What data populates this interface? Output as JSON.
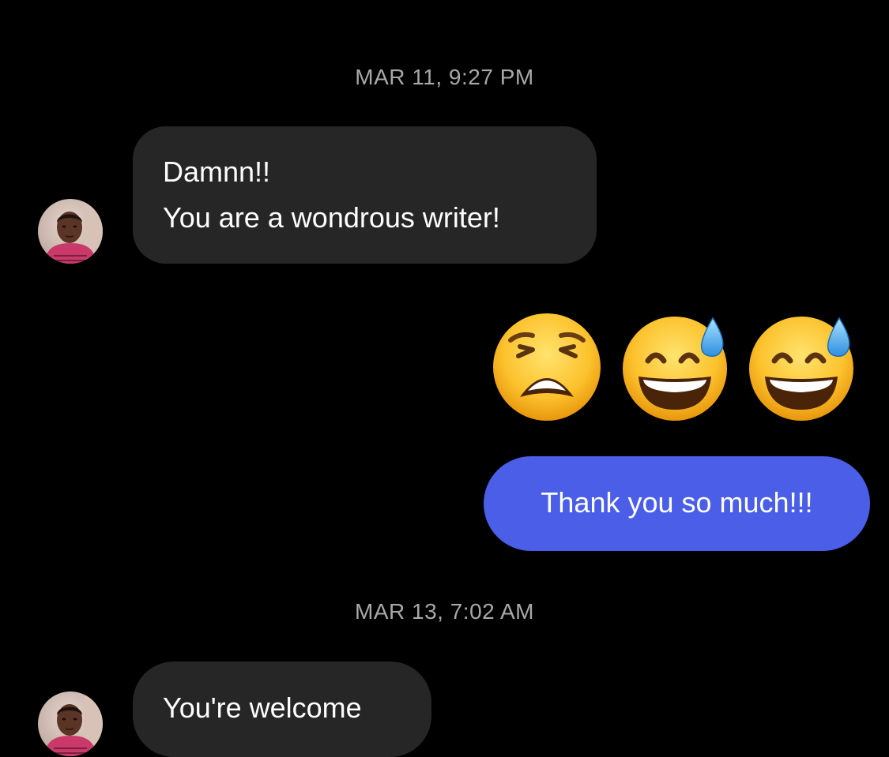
{
  "conversation": {
    "timestamps": [
      "MAR 11, 9:27 PM",
      "MAR 13, 7:02 AM"
    ],
    "messages": [
      {
        "sender": "them",
        "lines": [
          "Damnn!!",
          "You are a wondrous writer!"
        ]
      },
      {
        "sender": "me",
        "type": "emoji",
        "emojis": [
          "weary-face",
          "grinning-face-with-sweat",
          "grinning-face-with-sweat"
        ]
      },
      {
        "sender": "me",
        "text": "Thank you so much!!!"
      },
      {
        "sender": "them",
        "text": "You're welcome"
      }
    ]
  },
  "colors": {
    "background": "#000000",
    "incoming_bubble": "#262626",
    "outgoing_bubble": "#4a5ee8",
    "timestamp_text": "#a8a8a8",
    "message_text": "#ffffff"
  }
}
